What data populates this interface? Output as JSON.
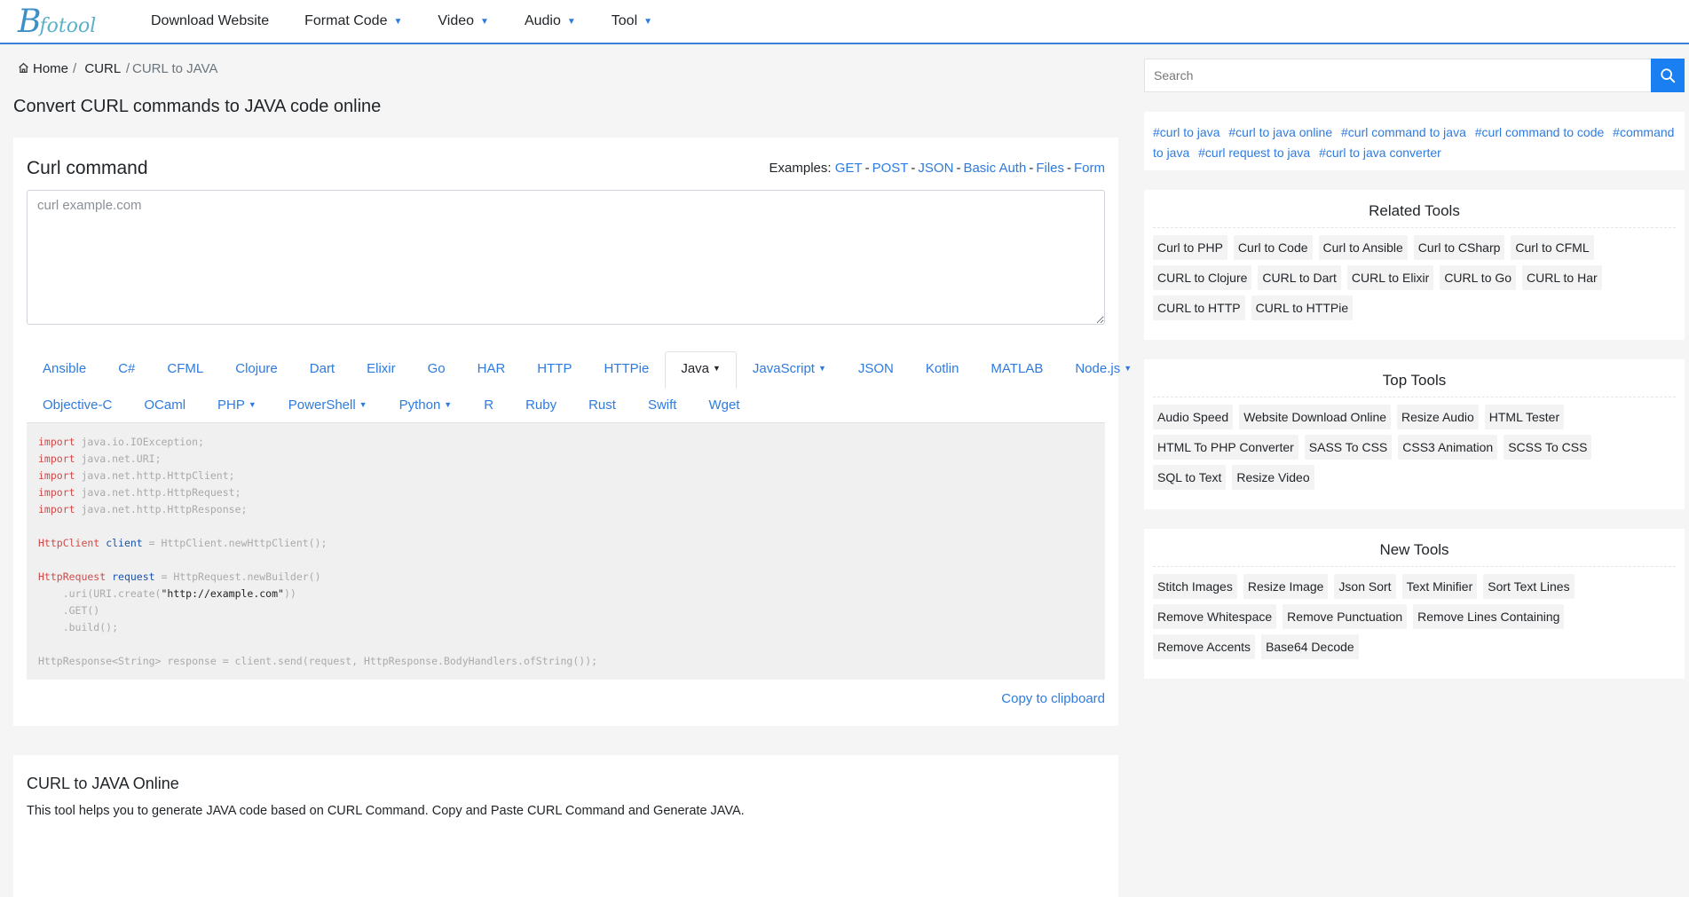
{
  "nav": {
    "logo_text": "fotool",
    "items": [
      {
        "label": "Download Website",
        "dropdown": false
      },
      {
        "label": "Format Code",
        "dropdown": true
      },
      {
        "label": "Video",
        "dropdown": true
      },
      {
        "label": "Audio",
        "dropdown": true
      },
      {
        "label": "Tool",
        "dropdown": true
      }
    ]
  },
  "breadcrumb": {
    "home": "Home",
    "sep": "/",
    "curl": "CURL",
    "current": "CURL to JAVA"
  },
  "page_title": "Convert CURL commands to JAVA code online",
  "converter": {
    "title": "Curl command",
    "examples_label": "Examples:",
    "examples": [
      "GET",
      "POST",
      "JSON",
      "Basic Auth",
      "Files",
      "Form"
    ],
    "input_placeholder": "curl example.com",
    "tabs_row1": [
      {
        "label": "Ansible",
        "dropdown": false
      },
      {
        "label": "C#",
        "dropdown": false
      },
      {
        "label": "CFML",
        "dropdown": false
      },
      {
        "label": "Clojure",
        "dropdown": false
      },
      {
        "label": "Dart",
        "dropdown": false
      },
      {
        "label": "Elixir",
        "dropdown": false
      },
      {
        "label": "Go",
        "dropdown": false
      },
      {
        "label": "HAR",
        "dropdown": false
      },
      {
        "label": "HTTP",
        "dropdown": false
      },
      {
        "label": "HTTPie",
        "dropdown": false
      },
      {
        "label": "Java",
        "dropdown": true,
        "active": true
      },
      {
        "label": "JavaScript",
        "dropdown": true
      },
      {
        "label": "JSON",
        "dropdown": false
      },
      {
        "label": "Kotlin",
        "dropdown": false
      },
      {
        "label": "MATLAB",
        "dropdown": false
      },
      {
        "label": "Node.js",
        "dropdown": true
      }
    ],
    "tabs_row2": [
      {
        "label": "Objective-C",
        "dropdown": false
      },
      {
        "label": "OCaml",
        "dropdown": false
      },
      {
        "label": "PHP",
        "dropdown": true
      },
      {
        "label": "PowerShell",
        "dropdown": true
      },
      {
        "label": "Python",
        "dropdown": true
      },
      {
        "label": "R",
        "dropdown": false
      },
      {
        "label": "Ruby",
        "dropdown": false
      },
      {
        "label": "Rust",
        "dropdown": false
      },
      {
        "label": "Swift",
        "dropdown": false
      },
      {
        "label": "Wget",
        "dropdown": false
      }
    ],
    "code_lines": [
      [
        [
          "kw",
          "import"
        ],
        [
          "",
          "java.io.IOException;"
        ]
      ],
      [
        [
          "kw",
          "import"
        ],
        [
          "",
          "java.net.URI;"
        ]
      ],
      [
        [
          "kw",
          "import"
        ],
        [
          "",
          "java.net.http.HttpClient;"
        ]
      ],
      [
        [
          "kw",
          "import"
        ],
        [
          "",
          "java.net.http.HttpRequest;"
        ]
      ],
      [
        [
          "kw",
          "import"
        ],
        [
          "",
          "java.net.http.HttpResponse;"
        ]
      ],
      [],
      [
        [
          "kw",
          "HttpClient"
        ],
        [
          "id",
          "client"
        ],
        [
          "",
          "= HttpClient.newHttpClient();"
        ]
      ],
      [],
      [
        [
          "kw",
          "HttpRequest"
        ],
        [
          "id",
          "request"
        ],
        [
          "",
          "= HttpRequest.newBuilder()"
        ]
      ],
      [
        [
          "",
          "    .uri(URI.create("
        ],
        [
          "st",
          "\"http://example.com\""
        ],
        [
          "",
          "))"
        ]
      ],
      [
        [
          "",
          "    .GET()"
        ]
      ],
      [
        [
          "",
          "    .build();"
        ]
      ],
      [],
      [
        [
          "",
          "HttpResponse<String> response = client.send(request, HttpResponse.BodyHandlers.ofString());"
        ]
      ]
    ],
    "copy_label": "Copy to clipboard"
  },
  "about": {
    "title": "CURL to JAVA Online",
    "text": "This tool helps you to generate JAVA code based on CURL Command. Copy and Paste CURL Command and Generate JAVA."
  },
  "sidebar": {
    "search_placeholder": "Search",
    "tags": [
      "#curl to java",
      "#curl to java online",
      "#curl command to java",
      "#curl command to code",
      "#command to java",
      "#curl request to java",
      "#curl to java converter"
    ],
    "related": {
      "title": "Related Tools",
      "items": [
        "Curl to PHP",
        "Curl to Code",
        "Curl to Ansible",
        "Curl to CSharp",
        "Curl to CFML",
        "CURL to Clojure",
        "CURL to Dart",
        "CURL to Elixir",
        "CURL to Go",
        "CURL to Har",
        "CURL to HTTP",
        "CURL to HTTPie"
      ]
    },
    "top": {
      "title": "Top Tools",
      "items": [
        "Audio Speed",
        "Website Download Online",
        "Resize Audio",
        "HTML Tester",
        "HTML To PHP Converter",
        "SASS To CSS",
        "CSS3 Animation",
        "SCSS To CSS",
        "SQL to Text",
        "Resize Video"
      ]
    },
    "new": {
      "title": "New Tools",
      "items": [
        "Stitch Images",
        "Resize Image",
        "Json Sort",
        "Text Minifier",
        "Sort Text Lines",
        "Remove Whitespace",
        "Remove Punctuation",
        "Remove Lines Containing",
        "Remove Accents",
        "Base64 Decode"
      ]
    }
  },
  "colors": {
    "accent": "#2d7be0",
    "nav_border": "#3a7fd8",
    "search_button": "#1a80f1",
    "code_keyword": "#d14a4a",
    "code_identifier": "#1a53a8"
  }
}
